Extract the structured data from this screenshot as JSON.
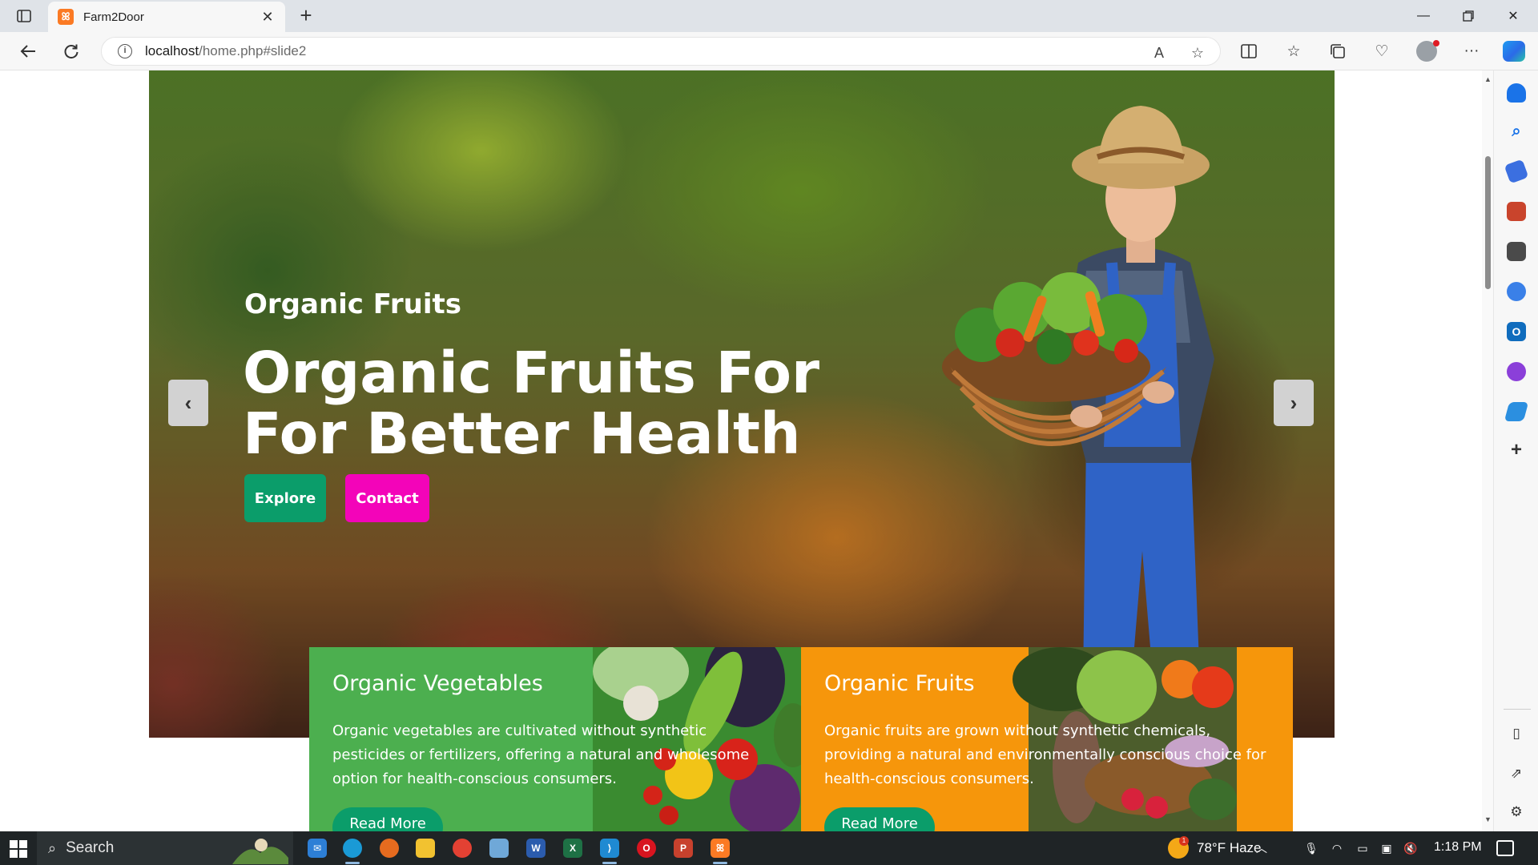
{
  "browser": {
    "tab_title": "Farm2Door",
    "tab_favicon": "xampp-icon",
    "new_tab_symbol": "+",
    "url_host": "localhost",
    "url_path": "/home.php#slide2"
  },
  "hero": {
    "subtitle": "Organic Fruits",
    "title": "Organic Fruits For For Better Health",
    "explore_label": "Explore",
    "contact_label": "Contact",
    "prev_symbol": "‹",
    "next_symbol": "›",
    "explore_color": "#0b9d6a",
    "contact_color": "#f304b9"
  },
  "cards": [
    {
      "title": "Organic Vegetables",
      "text": "Organic vegetables are cultivated without synthetic pesticides or fertilizers, offering a natural and wholesome option for health-conscious consumers.",
      "button": "Read More",
      "color": "#4caf4f"
    },
    {
      "title": "Organic Fruits",
      "text": "Organic fruits are grown without synthetic chemicals, providing a natural and environmentally conscious choice for health-conscious consumers.",
      "button": "Read More",
      "color": "#f6960b"
    }
  ],
  "taskbar": {
    "search_label": "Search",
    "weather": "78°F  Haze",
    "weather_badge": "1",
    "clock": "1:18 PM"
  }
}
